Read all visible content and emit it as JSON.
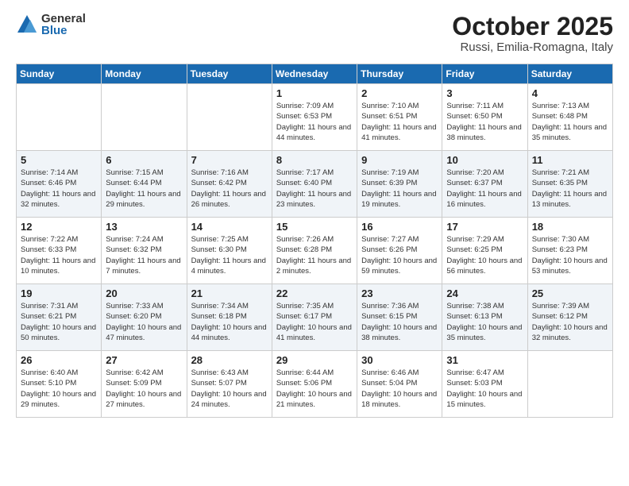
{
  "logo": {
    "general": "General",
    "blue": "Blue"
  },
  "title": "October 2025",
  "location": "Russi, Emilia-Romagna, Italy",
  "weekdays": [
    "Sunday",
    "Monday",
    "Tuesday",
    "Wednesday",
    "Thursday",
    "Friday",
    "Saturday"
  ],
  "weeks": [
    [
      {
        "day": "",
        "info": ""
      },
      {
        "day": "",
        "info": ""
      },
      {
        "day": "",
        "info": ""
      },
      {
        "day": "1",
        "info": "Sunrise: 7:09 AM\nSunset: 6:53 PM\nDaylight: 11 hours and 44 minutes."
      },
      {
        "day": "2",
        "info": "Sunrise: 7:10 AM\nSunset: 6:51 PM\nDaylight: 11 hours and 41 minutes."
      },
      {
        "day": "3",
        "info": "Sunrise: 7:11 AM\nSunset: 6:50 PM\nDaylight: 11 hours and 38 minutes."
      },
      {
        "day": "4",
        "info": "Sunrise: 7:13 AM\nSunset: 6:48 PM\nDaylight: 11 hours and 35 minutes."
      }
    ],
    [
      {
        "day": "5",
        "info": "Sunrise: 7:14 AM\nSunset: 6:46 PM\nDaylight: 11 hours and 32 minutes."
      },
      {
        "day": "6",
        "info": "Sunrise: 7:15 AM\nSunset: 6:44 PM\nDaylight: 11 hours and 29 minutes."
      },
      {
        "day": "7",
        "info": "Sunrise: 7:16 AM\nSunset: 6:42 PM\nDaylight: 11 hours and 26 minutes."
      },
      {
        "day": "8",
        "info": "Sunrise: 7:17 AM\nSunset: 6:40 PM\nDaylight: 11 hours and 23 minutes."
      },
      {
        "day": "9",
        "info": "Sunrise: 7:19 AM\nSunset: 6:39 PM\nDaylight: 11 hours and 19 minutes."
      },
      {
        "day": "10",
        "info": "Sunrise: 7:20 AM\nSunset: 6:37 PM\nDaylight: 11 hours and 16 minutes."
      },
      {
        "day": "11",
        "info": "Sunrise: 7:21 AM\nSunset: 6:35 PM\nDaylight: 11 hours and 13 minutes."
      }
    ],
    [
      {
        "day": "12",
        "info": "Sunrise: 7:22 AM\nSunset: 6:33 PM\nDaylight: 11 hours and 10 minutes."
      },
      {
        "day": "13",
        "info": "Sunrise: 7:24 AM\nSunset: 6:32 PM\nDaylight: 11 hours and 7 minutes."
      },
      {
        "day": "14",
        "info": "Sunrise: 7:25 AM\nSunset: 6:30 PM\nDaylight: 11 hours and 4 minutes."
      },
      {
        "day": "15",
        "info": "Sunrise: 7:26 AM\nSunset: 6:28 PM\nDaylight: 11 hours and 2 minutes."
      },
      {
        "day": "16",
        "info": "Sunrise: 7:27 AM\nSunset: 6:26 PM\nDaylight: 10 hours and 59 minutes."
      },
      {
        "day": "17",
        "info": "Sunrise: 7:29 AM\nSunset: 6:25 PM\nDaylight: 10 hours and 56 minutes."
      },
      {
        "day": "18",
        "info": "Sunrise: 7:30 AM\nSunset: 6:23 PM\nDaylight: 10 hours and 53 minutes."
      }
    ],
    [
      {
        "day": "19",
        "info": "Sunrise: 7:31 AM\nSunset: 6:21 PM\nDaylight: 10 hours and 50 minutes."
      },
      {
        "day": "20",
        "info": "Sunrise: 7:33 AM\nSunset: 6:20 PM\nDaylight: 10 hours and 47 minutes."
      },
      {
        "day": "21",
        "info": "Sunrise: 7:34 AM\nSunset: 6:18 PM\nDaylight: 10 hours and 44 minutes."
      },
      {
        "day": "22",
        "info": "Sunrise: 7:35 AM\nSunset: 6:17 PM\nDaylight: 10 hours and 41 minutes."
      },
      {
        "day": "23",
        "info": "Sunrise: 7:36 AM\nSunset: 6:15 PM\nDaylight: 10 hours and 38 minutes."
      },
      {
        "day": "24",
        "info": "Sunrise: 7:38 AM\nSunset: 6:13 PM\nDaylight: 10 hours and 35 minutes."
      },
      {
        "day": "25",
        "info": "Sunrise: 7:39 AM\nSunset: 6:12 PM\nDaylight: 10 hours and 32 minutes."
      }
    ],
    [
      {
        "day": "26",
        "info": "Sunrise: 6:40 AM\nSunset: 5:10 PM\nDaylight: 10 hours and 29 minutes."
      },
      {
        "day": "27",
        "info": "Sunrise: 6:42 AM\nSunset: 5:09 PM\nDaylight: 10 hours and 27 minutes."
      },
      {
        "day": "28",
        "info": "Sunrise: 6:43 AM\nSunset: 5:07 PM\nDaylight: 10 hours and 24 minutes."
      },
      {
        "day": "29",
        "info": "Sunrise: 6:44 AM\nSunset: 5:06 PM\nDaylight: 10 hours and 21 minutes."
      },
      {
        "day": "30",
        "info": "Sunrise: 6:46 AM\nSunset: 5:04 PM\nDaylight: 10 hours and 18 minutes."
      },
      {
        "day": "31",
        "info": "Sunrise: 6:47 AM\nSunset: 5:03 PM\nDaylight: 10 hours and 15 minutes."
      },
      {
        "day": "",
        "info": ""
      }
    ]
  ]
}
